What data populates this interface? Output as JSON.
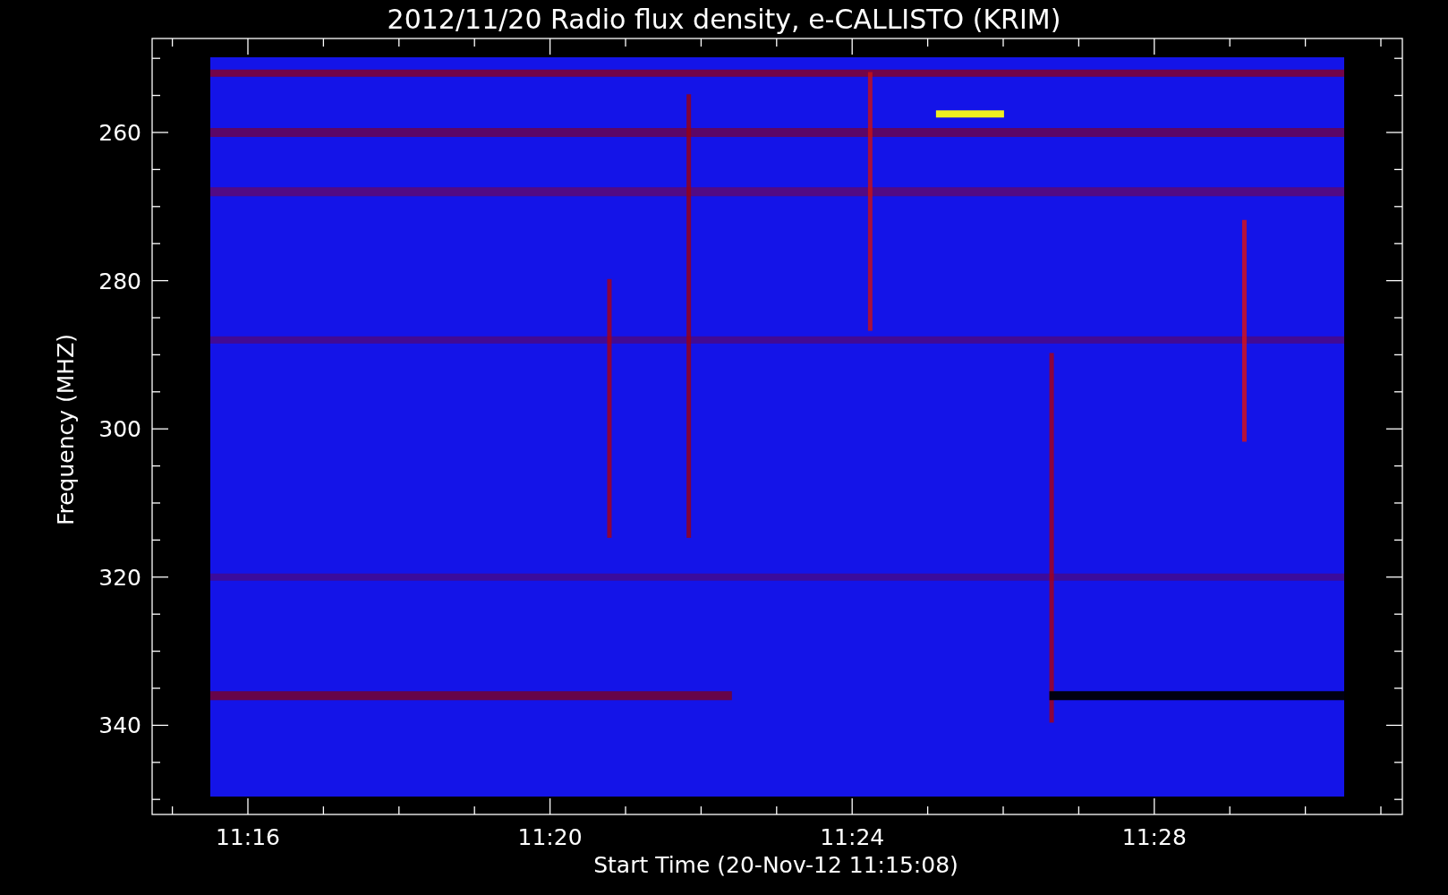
{
  "title": "2012/11/20  Radio flux density, e-CALLISTO (KRIM)",
  "y_axis": {
    "label": "Frequency (MHZ)",
    "ticks": [
      "260",
      "280",
      "300",
      "320",
      "340"
    ]
  },
  "x_axis": {
    "label": "Start Time (20-Nov-12 11:15:08)",
    "ticks": [
      "11:16",
      "11:20",
      "11:24",
      "11:28"
    ]
  }
}
